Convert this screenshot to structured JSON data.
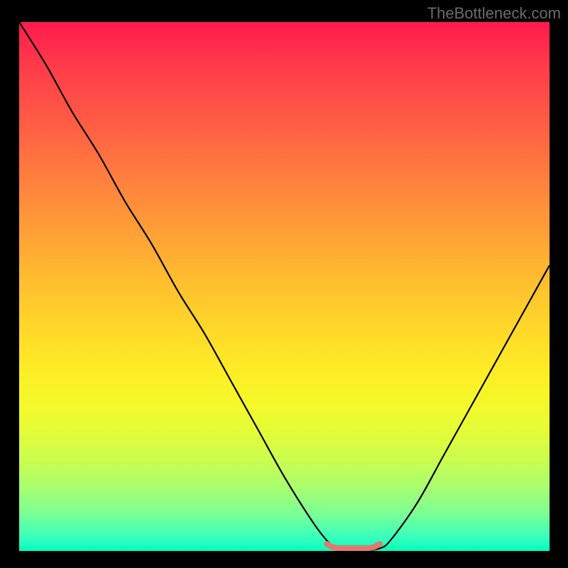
{
  "attribution": "TheBottleneck.com",
  "colors": {
    "frame": "#000000",
    "curve": "#000000",
    "floor_highlight": "#e07a6d",
    "gradient_top": "#ff1a4d",
    "gradient_bottom": "#00ffb9"
  },
  "chart_data": {
    "type": "line",
    "title": "",
    "xlabel": "",
    "ylabel": "",
    "xlim": [
      0,
      100
    ],
    "ylim": [
      0,
      100
    ],
    "x": [
      0,
      5,
      10,
      15,
      20,
      25,
      30,
      35,
      40,
      45,
      50,
      55,
      58,
      60,
      62,
      65,
      68,
      70,
      75,
      80,
      85,
      90,
      95,
      100
    ],
    "values": [
      100,
      92,
      83,
      75,
      66,
      58,
      49,
      41,
      32,
      23,
      14,
      6,
      2,
      0.5,
      0,
      0,
      0.5,
      2,
      9,
      18,
      27,
      36,
      45,
      54
    ],
    "floor_segment": {
      "x_start": 58,
      "x_end": 68,
      "y": 0
    },
    "notes": "V-shaped bottleneck curve; minimum region (green) roughly x=58–68; background is vertical heat gradient from red (high) to green (low)."
  }
}
